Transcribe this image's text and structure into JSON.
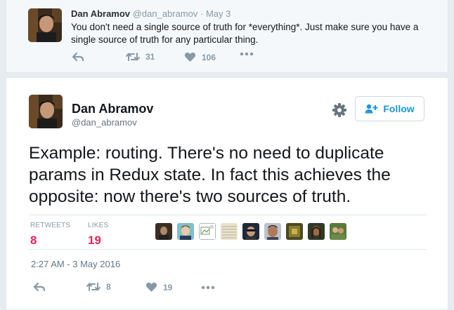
{
  "parent_tweet": {
    "name": "Dan Abramov",
    "handle": "@dan_abramov",
    "separator": "·",
    "date": "May 3",
    "text": "You don't need a single source of truth for *everything*. Just make sure you have a single source of truth for any particular thing.",
    "retweets": "31",
    "likes": "106"
  },
  "main_tweet": {
    "name": "Dan Abramov",
    "handle": "@dan_abramov",
    "follow_label": "Follow",
    "text": "Example: routing. There's no need to duplicate params in Redux state. In fact this achieves the opposite: now there's two sources of truth.",
    "stats": {
      "retweets_label": "RETWEETS",
      "retweets_value": "8",
      "likes_label": "LIKES",
      "likes_value": "19"
    },
    "timestamp": "2:27 AM - 3 May 2016",
    "actions": {
      "retweets": "8",
      "likes": "19"
    }
  },
  "colors": {
    "background": "#e6ecf0",
    "link_blue": "#1b95e0",
    "like_pink": "#e0245e",
    "muted": "#8899a6"
  },
  "icons": [
    "reply-icon",
    "retweet-icon",
    "heart-icon",
    "more-icon",
    "gear-icon",
    "add-person-icon",
    "broken-image-icon"
  ]
}
